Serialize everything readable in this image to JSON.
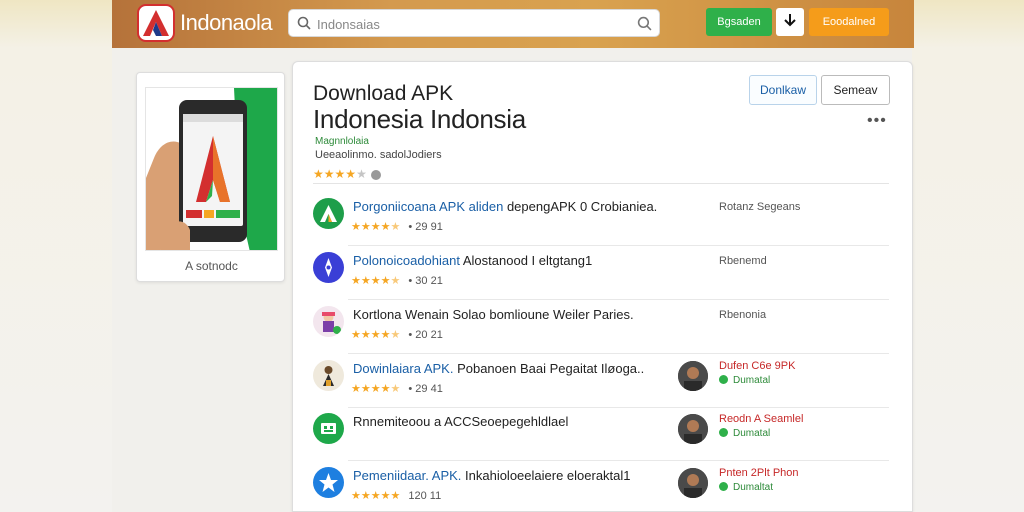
{
  "header": {
    "brand": "Indonaola",
    "search_placeholder": "Indonsaias",
    "btn_green": "Bgsaden",
    "btn_orange": "Eoodalned"
  },
  "left_card": {
    "caption": "A sotnodc"
  },
  "app": {
    "title_line1": "Download APK",
    "title_line2": "Indonesia Indonsia",
    "subtitle_green": "Magnnlolaia",
    "subtitle": "Ueeaolinmo. sadolJodiers",
    "rating_stars": 4,
    "btn_download": "Donlkaw",
    "btn_secondary": "Semeav",
    "more": "•••"
  },
  "list": [
    {
      "title_hl": "Porgoniicoana APK aliden",
      "title_rest": "depengAPK 0 Crobianiea.",
      "stars": 4.5,
      "count": "• 29 91",
      "side": "Rotanz Segeans",
      "icon": "android-icon",
      "icon_bg": "#1e9e4a"
    },
    {
      "title_hl": "Polonoicoadohiant",
      "title_rest": "Alostanood I eltgtang1",
      "stars": 4.5,
      "count": "• 30 21",
      "side": "Rbenemd",
      "icon": "compass-icon",
      "icon_bg": "#3a3fd6"
    },
    {
      "title_hl": "",
      "title_rest": "Kortlona Wenain Solao bomlioune Weiler Paries.",
      "stars": 4.5,
      "count": "• 20 21",
      "side": "Rbenonia",
      "icon": "character-icon",
      "icon_bg": "#f3e6ee"
    },
    {
      "title_hl": "Dowinlaiara APK.",
      "title_rest": "Pobanoen Baai Pegaitat Iløoga..",
      "stars": 4.5,
      "count": "• 29 41",
      "publisher_name": "Dufen C6e 9PK",
      "publisher_meta": "Dumatal",
      "icon": "game-icon",
      "icon_bg": "#efe9dc"
    },
    {
      "title_hl": "",
      "title_rest": "Rnnemiteoou a ACCSeoepegehldlael",
      "stars": 0,
      "count": "",
      "publisher_name": "Reodn A Seamlel",
      "publisher_meta": "Dumatal",
      "icon": "grid-icon",
      "icon_bg": "#1ea84a"
    },
    {
      "title_hl": "Pemeniidaar. APK.",
      "title_rest": "Inkahioloeelaiere eloeraktal1",
      "stars": 5,
      "count": "120 11",
      "publisher_name": "Pnten 2Plt Phon",
      "publisher_meta": "Dumaltat",
      "icon": "star-icon",
      "icon_bg": "#1e7fe0"
    }
  ],
  "colors": {
    "topbar": "#c98a42",
    "green": "#2fb04a",
    "orange": "#f59c1a",
    "link_blue": "#1a5fa6",
    "star": "#f5a623",
    "publisher_red": "#c62828"
  }
}
